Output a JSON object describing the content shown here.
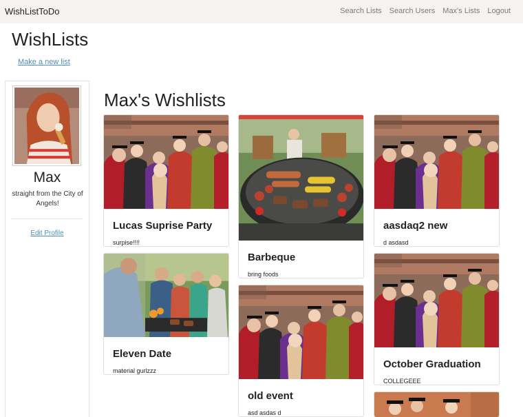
{
  "brand": "WishListToDo",
  "nav": [
    "Search Lists",
    "Search Users",
    "Max's Lists",
    "Logout"
  ],
  "page_title": "WishLists",
  "new_list_link": "Make a new list",
  "profile": {
    "name": "Max",
    "bio": "straight from the City of Angels!",
    "edit_link": "Edit Profile"
  },
  "section_title": "Max's Wishlists",
  "cards": [
    {
      "title": "Lucas Suprise Party",
      "description": "surpise!!!!",
      "image": "graduation-photo"
    },
    {
      "title": "Barbeque",
      "description": "bring foods",
      "image": "grill-photo"
    },
    {
      "title": "aasdaq2 new",
      "description": "d asdasd",
      "image": "graduation-photo"
    },
    {
      "title": "Eleven Date",
      "description": "material gurlzzz",
      "image": "friends-bbq-photo"
    },
    {
      "title": "old event",
      "description": "asd asdas d",
      "image": "graduation-photo"
    },
    {
      "title": "October Graduation",
      "description": "COLLEGEEE",
      "image": "graduation-photo"
    },
    {
      "title": "",
      "description": "",
      "image": "graduation-photo"
    }
  ]
}
